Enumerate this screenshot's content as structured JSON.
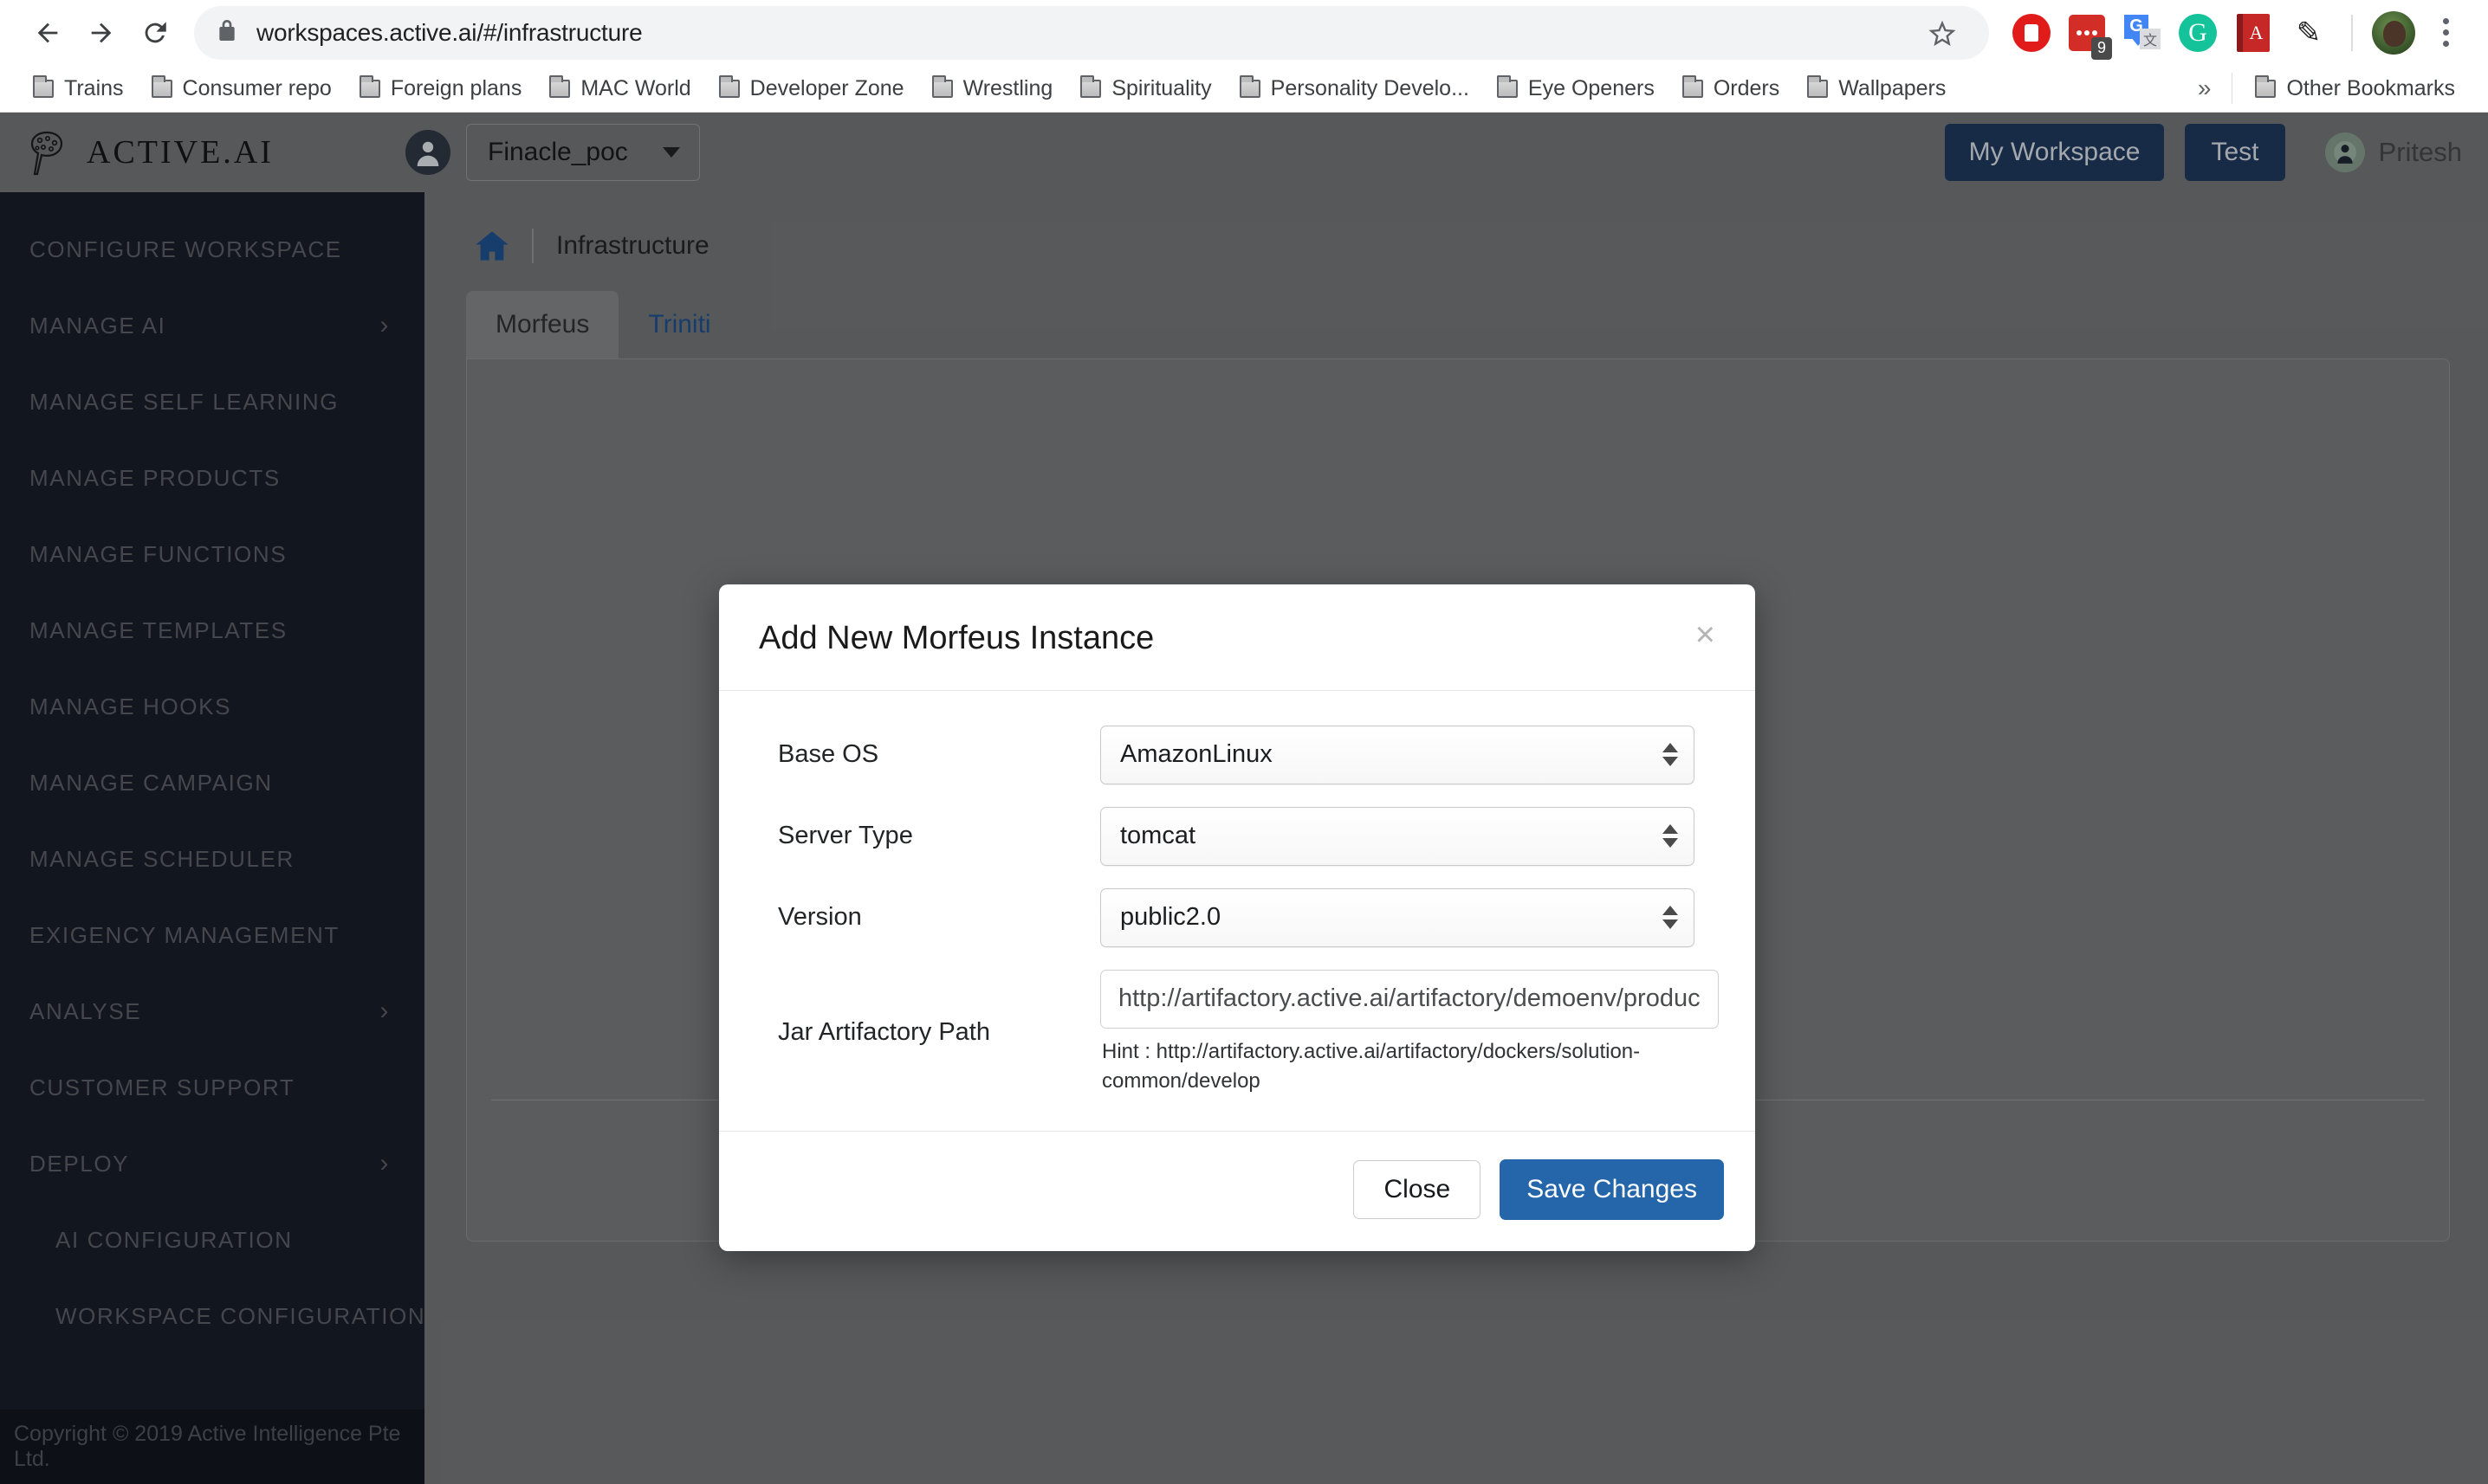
{
  "browser": {
    "url": "workspaces.active.ai/#/infrastructure",
    "nav": {
      "back": "back-arrow",
      "forward": "forward-arrow",
      "reload": "reload-arrow"
    },
    "lock_icon": "lock-icon",
    "star_icon": "bookmark-star-icon",
    "extensions": [
      {
        "name": "adblock-icon",
        "badge": ""
      },
      {
        "name": "lastpass-icon",
        "badge": "9"
      },
      {
        "name": "google-translate-icon",
        "badge": ""
      },
      {
        "name": "grammarly-icon",
        "badge": "",
        "glyph": "G"
      },
      {
        "name": "dictionary-icon",
        "badge": "",
        "glyph": "A"
      },
      {
        "name": "pen-icon",
        "badge": "",
        "glyph": "✎"
      }
    ],
    "profile_avatar": "profile-avatar",
    "menu_icon": "chrome-menu-icon",
    "bookmarks": [
      "Trains",
      "Consumer repo",
      "Foreign plans",
      "MAC World",
      "Developer Zone",
      "Wrestling",
      "Spirituality",
      "Personality Develo...",
      "Eye Openers",
      "Orders",
      "Wallpapers"
    ],
    "bookmarks_overflow": "»",
    "other_bookmarks": "Other Bookmarks"
  },
  "app_header": {
    "logo_text": "ACTIVE.AI",
    "workspace_name": "Finacle_poc",
    "my_workspace_label": "My Workspace",
    "test_label": "Test",
    "user_name": "Pritesh"
  },
  "sidebar": {
    "items": [
      {
        "label": "CONFIGURE WORKSPACE",
        "chevron": false,
        "sub": false
      },
      {
        "label": "MANAGE AI",
        "chevron": true,
        "sub": false
      },
      {
        "label": "MANAGE SELF LEARNING",
        "chevron": false,
        "sub": false
      },
      {
        "label": "MANAGE PRODUCTS",
        "chevron": false,
        "sub": false
      },
      {
        "label": "MANAGE FUNCTIONS",
        "chevron": false,
        "sub": false
      },
      {
        "label": "MANAGE TEMPLATES",
        "chevron": false,
        "sub": false
      },
      {
        "label": "MANAGE HOOKS",
        "chevron": false,
        "sub": false
      },
      {
        "label": "MANAGE CAMPAIGN",
        "chevron": false,
        "sub": false
      },
      {
        "label": "MANAGE SCHEDULER",
        "chevron": false,
        "sub": false
      },
      {
        "label": "EXIGENCY MANAGEMENT",
        "chevron": false,
        "sub": false
      },
      {
        "label": "ANALYSE",
        "chevron": true,
        "sub": false
      },
      {
        "label": "CUSTOMER SUPPORT",
        "chevron": false,
        "sub": false
      },
      {
        "label": "DEPLOY",
        "chevron": true,
        "sub": false
      },
      {
        "label": "AI CONFIGURATION",
        "chevron": false,
        "sub": true
      },
      {
        "label": "WORKSPACE CONFIGURATION",
        "chevron": false,
        "sub": true
      }
    ],
    "chevron_glyph": "›",
    "copyright": "Copyright © 2019 Active Intelligence Pte Ltd."
  },
  "main": {
    "home_icon": "home-icon",
    "breadcrumb": "Infrastructure",
    "tabs": [
      {
        "label": "Morfeus",
        "active": true
      },
      {
        "label": "Triniti",
        "active": false
      }
    ]
  },
  "modal": {
    "title": "Add New Morfeus Instance",
    "close_glyph": "×",
    "fields": [
      {
        "label": "Base OS",
        "value": "AmazonLinux",
        "type": "select"
      },
      {
        "label": "Server Type",
        "value": "tomcat",
        "type": "select"
      },
      {
        "label": "Version",
        "value": "public2.0",
        "type": "select"
      }
    ],
    "path_field": {
      "label": "Jar Artifactory Path",
      "value": "http://artifactory.active.ai/artifactory/demoenv/produc",
      "hint": "Hint : http://artifactory.active.ai/artifactory/dockers/solution-common/develop"
    },
    "close_label": "Close",
    "save_label": "Save Changes"
  },
  "colors": {
    "accent_blue": "#2566ab",
    "header_blue": "#1d3557",
    "sidebar_bg": "#161b25",
    "app_bg": "#6a6c6e"
  }
}
